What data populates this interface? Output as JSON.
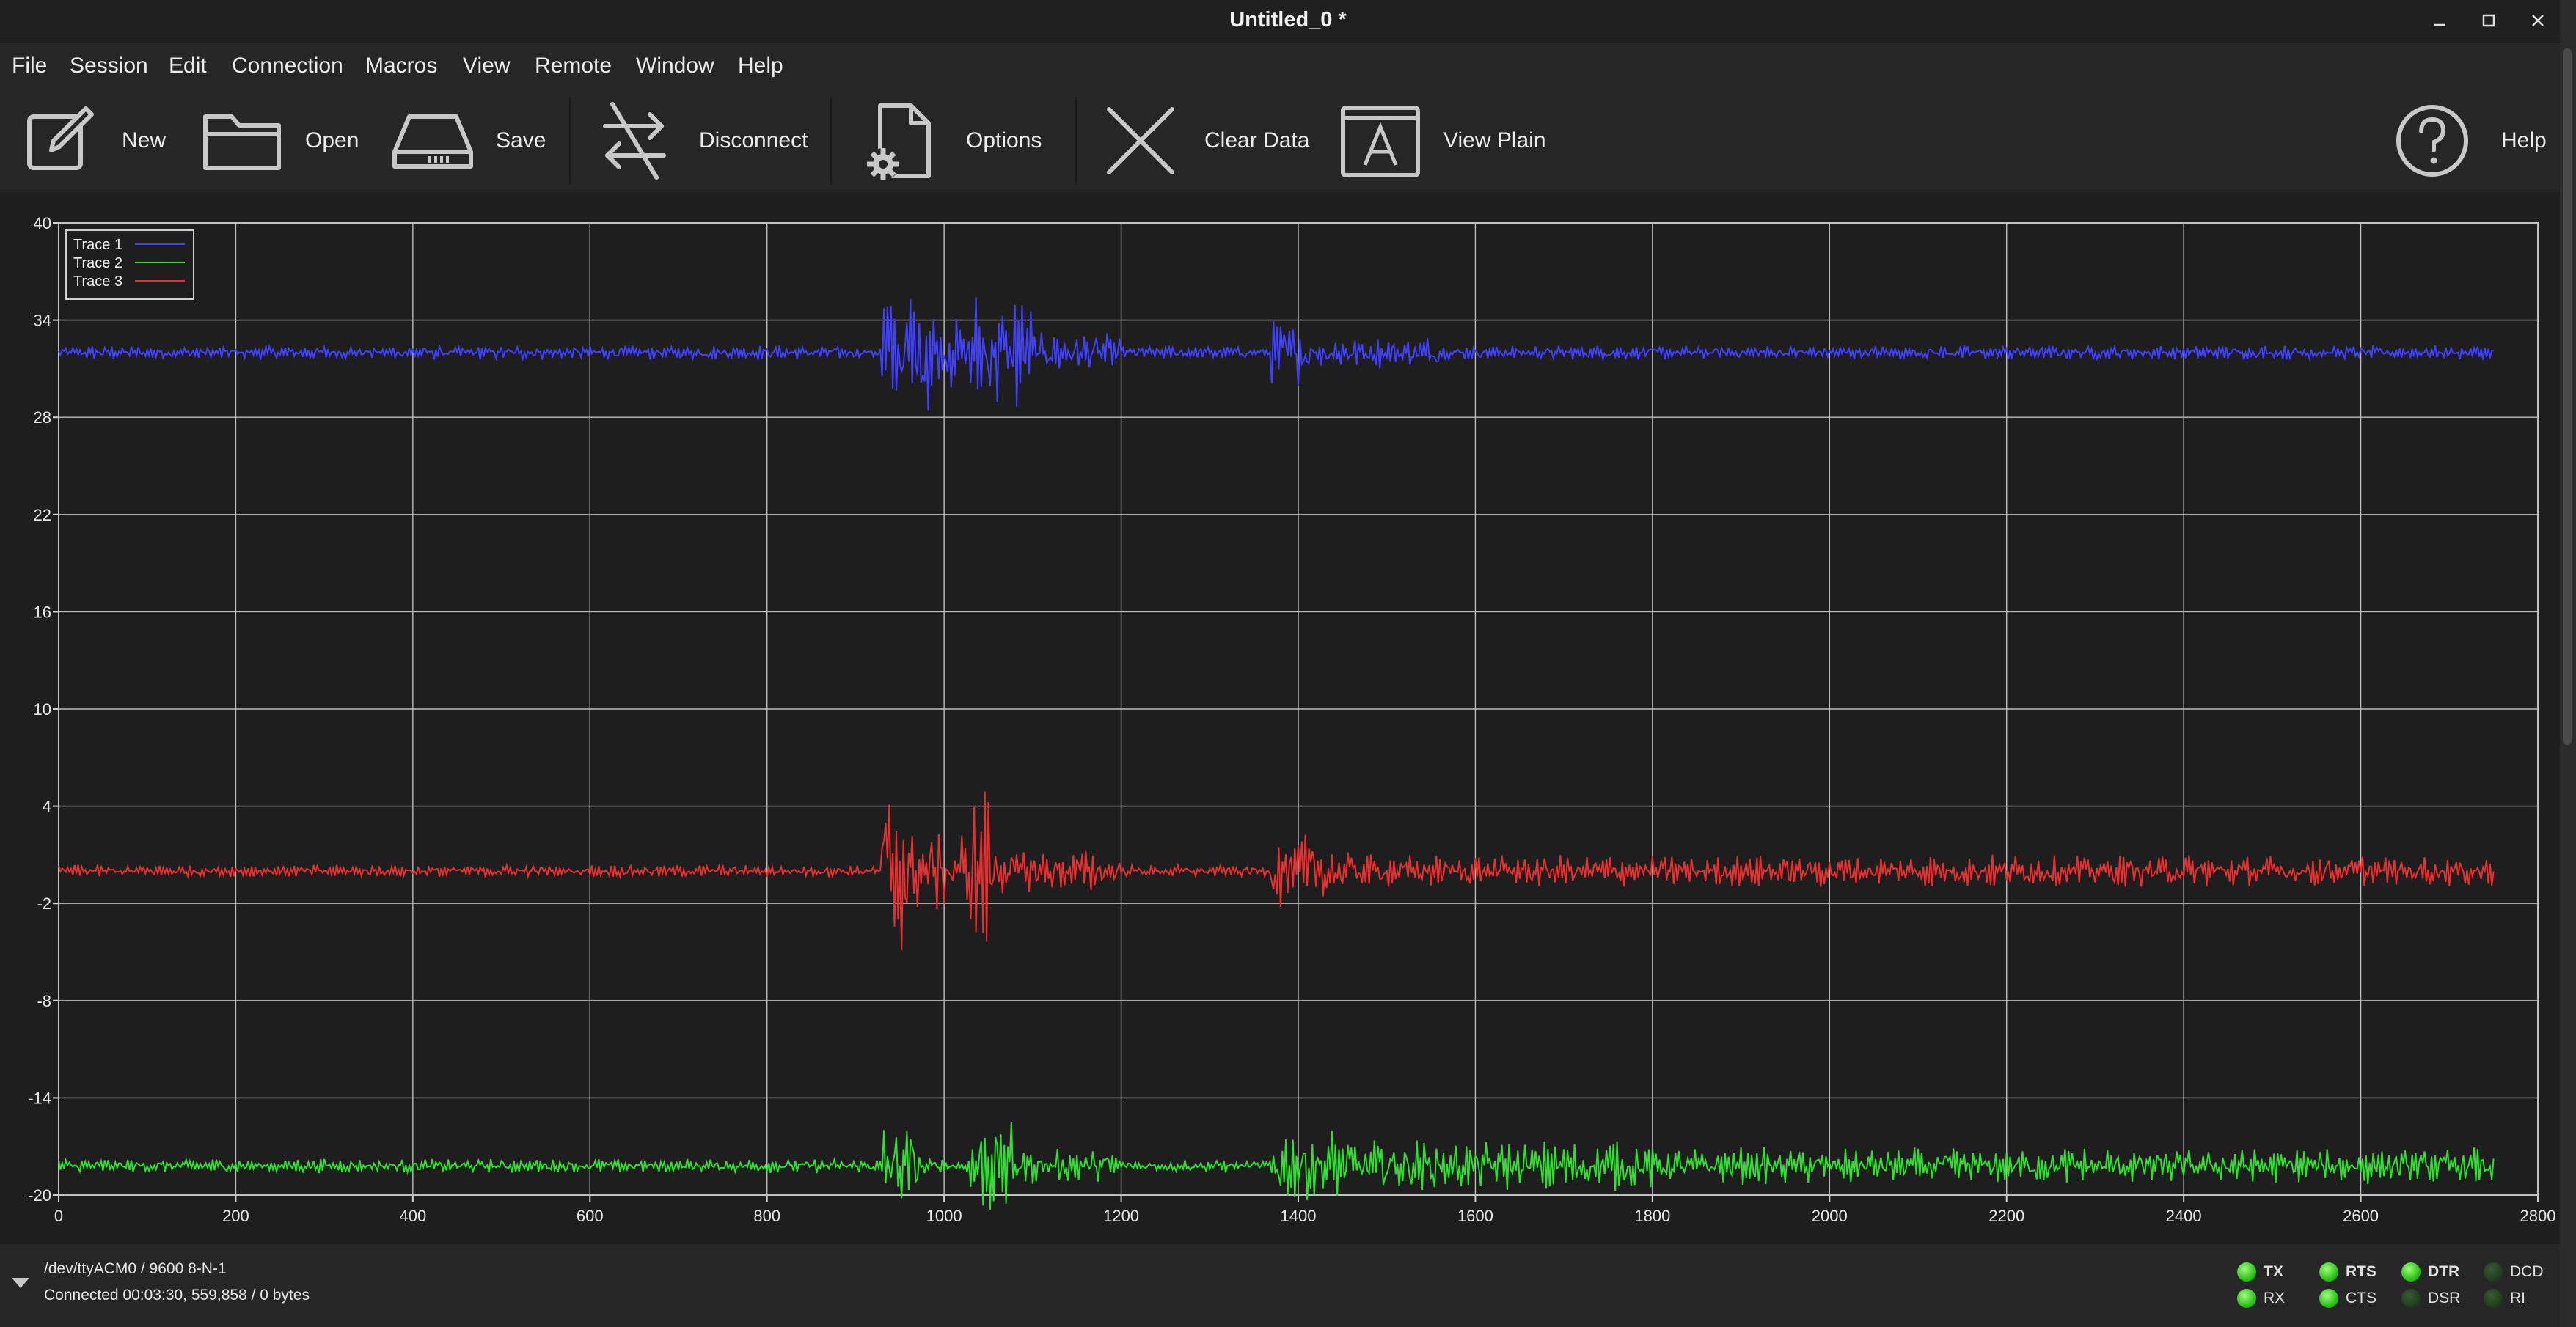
{
  "window": {
    "title": "Untitled_0 *"
  },
  "menu": [
    "File",
    "Session",
    "Edit",
    "Connection",
    "Macros",
    "View",
    "Remote",
    "Window",
    "Help"
  ],
  "toolbar": {
    "new_label": "New",
    "open_label": "Open",
    "save_label": "Save",
    "disconnect_label": "Disconnect",
    "options_label": "Options",
    "clear_label": "Clear Data",
    "viewplain_label": "View Plain",
    "help_label": "Help"
  },
  "status": {
    "port": "/dev/ttyACM0 / 9600 8-N-1",
    "connection": "Connected 00:03:30, 559,858 / 0 bytes"
  },
  "signals": [
    {
      "name": "TX",
      "on": true,
      "bold": true
    },
    {
      "name": "RX",
      "on": true,
      "bold": false
    },
    {
      "name": "RTS",
      "on": true,
      "bold": true
    },
    {
      "name": "CTS",
      "on": true,
      "bold": false
    },
    {
      "name": "DTR",
      "on": true,
      "bold": true
    },
    {
      "name": "DSR",
      "on": false,
      "bold": false
    },
    {
      "name": "DCD",
      "on": false,
      "bold": false
    },
    {
      "name": "RI",
      "on": false,
      "bold": false
    }
  ],
  "chart_data": {
    "type": "line",
    "xlim": [
      0,
      2800
    ],
    "ylim": [
      -20,
      40
    ],
    "xticks": [
      0,
      200,
      400,
      600,
      800,
      1000,
      1200,
      1400,
      1600,
      1800,
      2000,
      2200,
      2400,
      2600,
      2800
    ],
    "yticks": [
      40,
      34,
      28,
      22,
      16,
      10,
      4,
      -2,
      -8,
      -14,
      -20
    ],
    "grid": true,
    "legend_position": "top-left",
    "x_end": 2750,
    "series": [
      {
        "name": "Trace 1",
        "color": "#4040ff",
        "baseline": 32,
        "noise": 0.35,
        "bursts": [
          {
            "x": [
              930,
              990
            ],
            "amp": 3.2
          },
          {
            "x": [
              990,
              1030
            ],
            "amp": 1.8
          },
          {
            "x": [
              1030,
              1100
            ],
            "amp": 3.0
          },
          {
            "x": [
              1100,
              1200
            ],
            "amp": 1.0
          },
          {
            "x": [
              1370,
              1420
            ],
            "amp": 1.6
          },
          {
            "x": [
              1420,
              1560
            ],
            "amp": 0.8
          }
        ]
      },
      {
        "name": "Trace 2",
        "color": "#30e030",
        "baseline": -18.2,
        "noise": 0.35,
        "bursts": [
          {
            "x": [
              930,
              980
            ],
            "amp": 2.2
          },
          {
            "x": [
              1030,
              1080
            ],
            "amp": 2.4
          },
          {
            "x": [
              1080,
              1200
            ],
            "amp": 0.9
          },
          {
            "x": [
              1370,
              1460
            ],
            "amp": 1.8
          },
          {
            "x": [
              1460,
              1800
            ],
            "amp": 1.3
          },
          {
            "x": [
              1800,
              2750
            ],
            "amp": 0.9
          }
        ]
      },
      {
        "name": "Trace 3",
        "color": "#e83030",
        "baseline": 0,
        "noise": 0.3,
        "bursts": [
          {
            "x": [
              930,
              960
            ],
            "amp": 4.8
          },
          {
            "x": [
              960,
              1030
            ],
            "amp": 2.0
          },
          {
            "x": [
              1030,
              1060
            ],
            "amp": 4.5
          },
          {
            "x": [
              1060,
              1200
            ],
            "amp": 1.1
          },
          {
            "x": [
              1370,
              1460
            ],
            "amp": 1.8
          },
          {
            "x": [
              1460,
              2750
            ],
            "amp": 0.8
          }
        ]
      }
    ]
  }
}
